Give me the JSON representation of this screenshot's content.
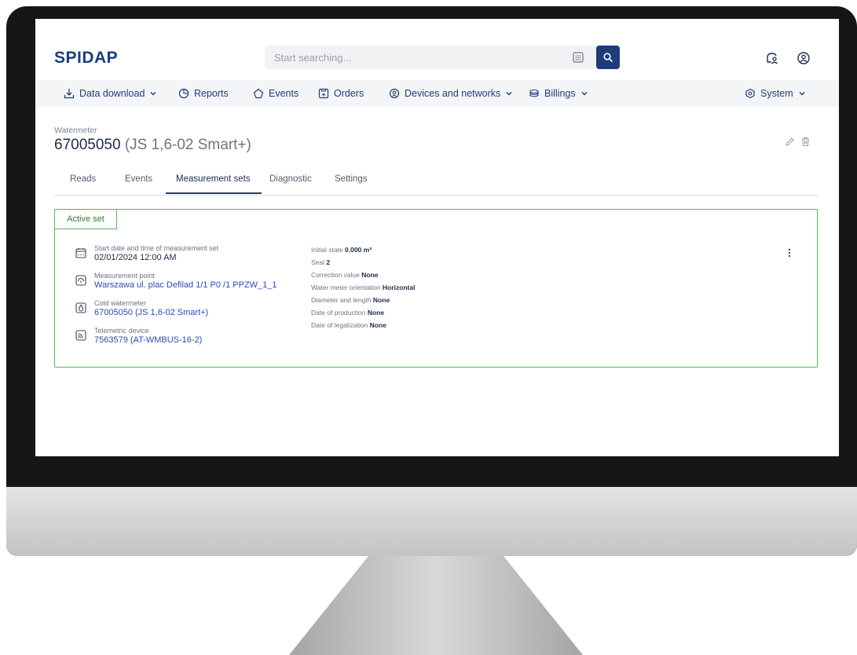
{
  "header": {
    "logo": "SPIDAP",
    "search_placeholder": "Start searching..."
  },
  "nav": {
    "items": [
      {
        "label": "Data download",
        "dropdown": true
      },
      {
        "label": "Reports",
        "dropdown": false
      },
      {
        "label": "Events",
        "dropdown": false
      },
      {
        "label": "Orders",
        "dropdown": false
      },
      {
        "label": "Devices and networks",
        "dropdown": true
      },
      {
        "label": "Billings",
        "dropdown": true
      }
    ],
    "system": {
      "label": "System",
      "dropdown": true
    }
  },
  "page": {
    "breadcrumb": "Watermeter",
    "title_main": "67005050",
    "title_sub": " (JS 1,6-02 Smart+)"
  },
  "tabs": [
    "Reads",
    "Events",
    "Measurement sets",
    "Diagnostic",
    "Settings"
  ],
  "active_tab": "Measurement sets",
  "card": {
    "tag": "Active set",
    "fields": [
      {
        "label": "Start date and time of measurement set",
        "value": "02/01/2024 12:00 AM",
        "icon": "calendar-icon"
      },
      {
        "label": "Measurement point",
        "value": "Warszawa ul. plac Defilad 1/1 P0 /1 PPZW_1_1",
        "icon": "measurement-point-icon"
      },
      {
        "label": "Cold watermeter",
        "value": "67005050 (JS 1,6-02 Smart+)",
        "icon": "watermeter-icon"
      },
      {
        "label": "Telemetric device",
        "value": "7563579 (AT-WMBUS-16-2)",
        "icon": "telemetric-device-icon"
      }
    ],
    "properties": [
      {
        "label": "Initial state",
        "value": "0.000 m³"
      },
      {
        "label": "Seal",
        "value": "2"
      },
      {
        "label": "Correction value",
        "value": "None"
      },
      {
        "label": "Water meter orientation",
        "value": "Horizontal"
      },
      {
        "label": "Diameter and length",
        "value": "None"
      },
      {
        "label": "Date of production",
        "value": "None"
      },
      {
        "label": "Date of legalization",
        "value": "None"
      }
    ]
  },
  "colors": {
    "brand": "#1e3d78",
    "link": "#2a4cb3",
    "active_border": "#5fb45c",
    "nav_bg": "#f4f5f7"
  }
}
